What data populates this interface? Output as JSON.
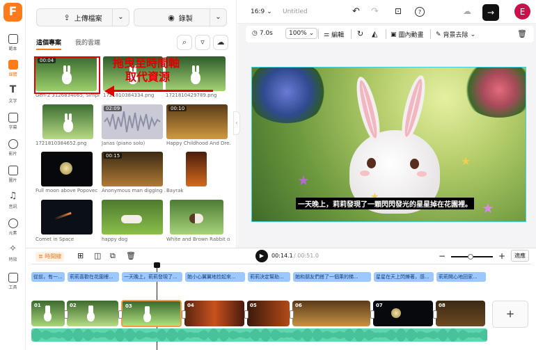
{
  "rail": {
    "logo": "F",
    "items": [
      {
        "label": "範本",
        "icon": "layout-icon"
      },
      {
        "label": "媒體",
        "icon": "upload-icon"
      },
      {
        "label": "文字",
        "icon": "text-icon"
      },
      {
        "label": "字幕",
        "icon": "subtitle-icon"
      },
      {
        "label": "影片",
        "icon": "video-icon"
      },
      {
        "label": "圖片",
        "icon": "image-icon"
      },
      {
        "label": "音訊",
        "icon": "music-icon"
      },
      {
        "label": "元素",
        "icon": "elements-icon"
      },
      {
        "label": "特效",
        "icon": "effects-icon"
      },
      {
        "label": "工具",
        "icon": "toolbox-icon"
      }
    ]
  },
  "media_panel": {
    "upload_label": "上傳檔案",
    "record_label": "錄製",
    "tabs": [
      "這個專案",
      "我的雲端"
    ],
    "items": [
      {
        "caption": "Gen-2 3126834065, Simple...",
        "duration": "00:04"
      },
      {
        "caption": "1721810384334.png",
        "duration": ""
      },
      {
        "caption": "1721810429789.png",
        "duration": ""
      },
      {
        "caption": "1721810384652.png",
        "duration": ""
      },
      {
        "caption": "Janas (piano solo)",
        "duration": "02:09"
      },
      {
        "caption": "Happy Childhood And Dre...",
        "duration": "00:10"
      },
      {
        "caption": "Full moon above Popovec",
        "duration": ""
      },
      {
        "caption": "Anonymous man digging ...",
        "duration": "00:15"
      },
      {
        "caption": "Bayrak",
        "duration": ""
      },
      {
        "caption": "Comet in Space",
        "duration": ""
      },
      {
        "caption": "happy dog",
        "duration": ""
      },
      {
        "caption": "White and Brown Rabbit o...",
        "duration": ""
      }
    ]
  },
  "annotation": {
    "line1": "拖曳至時間軸",
    "line2": "取代資源"
  },
  "topbar": {
    "ratio": "16:9",
    "title": "Untitled",
    "avatar": "E"
  },
  "toolbar": {
    "duration": "7.0s",
    "zoom": "100%",
    "edit": "編輯",
    "animation": "圖內動畫",
    "remove_bg": "背景去除"
  },
  "canvas": {
    "subtitle": "一天晚上，莉莉發現了一顆閃閃發光的星星掉在花園裡。"
  },
  "timeline": {
    "mode_label": "時間線",
    "current_time": "00:14.1",
    "total_time": "/ 00:51.0",
    "fit_label": "適應",
    "subtitles": [
      "從前，有一...",
      "莉莉喜歡在花園裡...",
      "一天晚上，莉莉發現了...",
      "她小心翼翼地捡起來...",
      "莉莉決定幫助...",
      "她和朋友們搭了一個乘的梯...",
      "星星在天上閃爍著，感...",
      "莉莉開心地回家..."
    ],
    "clips": [
      "01",
      "02",
      "03",
      "04",
      "05",
      "06",
      "07",
      "08"
    ],
    "add_label": "+"
  },
  "colors": {
    "accent": "#ff7a1a",
    "selection": "#3fd0e0",
    "annotation": "#e00000",
    "subtitle_chip": "#9cc7ff",
    "audio_wave": "#5fd6b0"
  }
}
